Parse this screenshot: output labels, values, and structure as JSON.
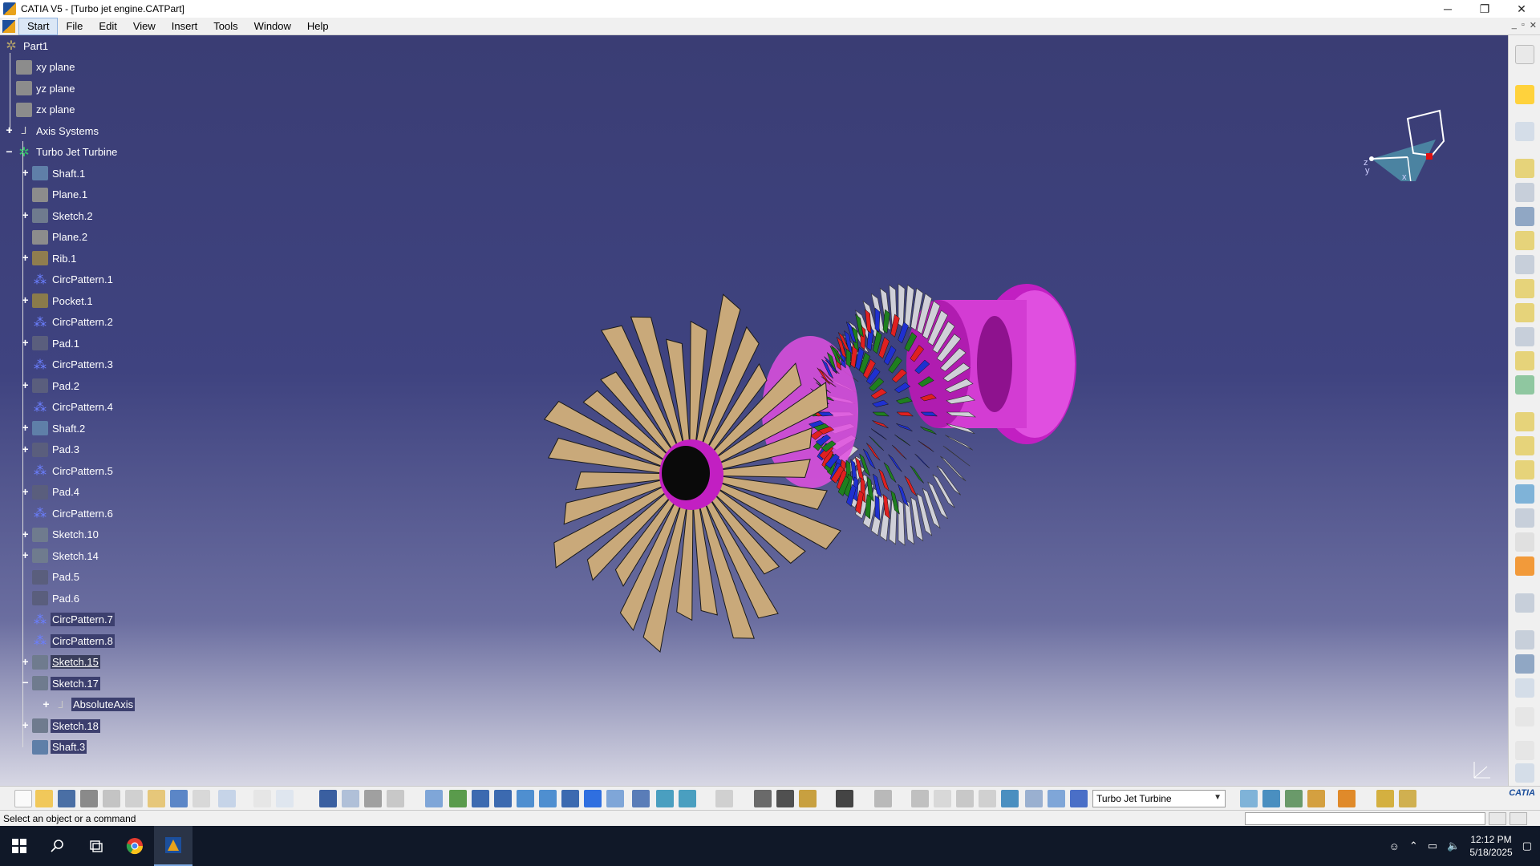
{
  "window": {
    "title": "CATIA V5 - [Turbo jet engine.CATPart]",
    "minimize": "─",
    "maximize": "❐",
    "close": "✕"
  },
  "menu": {
    "items": [
      "Start",
      "File",
      "Edit",
      "View",
      "Insert",
      "Tools",
      "Window",
      "Help"
    ],
    "mdi": [
      "_",
      "▫",
      "✕"
    ]
  },
  "tree": {
    "root": "Part1",
    "nodes": [
      {
        "label": "xy plane",
        "icon": "plane-icon"
      },
      {
        "label": "yz plane",
        "icon": "plane-icon"
      },
      {
        "label": "zx plane",
        "icon": "plane-icon"
      },
      {
        "label": "Axis Systems",
        "icon": "axis-system-icon"
      },
      {
        "label": "Turbo Jet Turbine",
        "icon": "part-body-icon"
      },
      {
        "label": "Shaft.1",
        "icon": "shaft-icon"
      },
      {
        "label": "Plane.1",
        "icon": "plane-icon"
      },
      {
        "label": "Sketch.2",
        "icon": "sketch-icon"
      },
      {
        "label": "Plane.2",
        "icon": "plane-icon"
      },
      {
        "label": "Rib.1",
        "icon": "rib-icon"
      },
      {
        "label": "CircPattern.1",
        "icon": "circ-pattern-icon"
      },
      {
        "label": "Pocket.1",
        "icon": "pocket-icon"
      },
      {
        "label": "CircPattern.2",
        "icon": "circ-pattern-icon"
      },
      {
        "label": "Pad.1",
        "icon": "pad-icon"
      },
      {
        "label": "CircPattern.3",
        "icon": "circ-pattern-icon"
      },
      {
        "label": "Pad.2",
        "icon": "pad-icon"
      },
      {
        "label": "CircPattern.4",
        "icon": "circ-pattern-icon"
      },
      {
        "label": "Shaft.2",
        "icon": "shaft-icon"
      },
      {
        "label": "Pad.3",
        "icon": "pad-icon"
      },
      {
        "label": "CircPattern.5",
        "icon": "circ-pattern-icon"
      },
      {
        "label": "Pad.4",
        "icon": "pad-icon"
      },
      {
        "label": "CircPattern.6",
        "icon": "circ-pattern-icon"
      },
      {
        "label": "Sketch.10",
        "icon": "sketch-icon"
      },
      {
        "label": "Sketch.14",
        "icon": "sketch-icon"
      },
      {
        "label": "Pad.5",
        "icon": "pad-icon"
      },
      {
        "label": "Pad.6",
        "icon": "pad-icon"
      },
      {
        "label": "CircPattern.7",
        "icon": "circ-pattern-icon"
      },
      {
        "label": "CircPattern.8",
        "icon": "circ-pattern-icon"
      },
      {
        "label": "Sketch.15",
        "icon": "sketch-icon"
      },
      {
        "label": "Sketch.17",
        "icon": "sketch-icon"
      },
      {
        "label": "AbsoluteAxis",
        "icon": "absolute-axis-icon"
      },
      {
        "label": "Sketch.18",
        "icon": "sketch-icon"
      },
      {
        "label": "Shaft.3",
        "icon": "shaft-icon"
      }
    ]
  },
  "compass": {
    "x_label": "x",
    "y_label": "y",
    "z_label": "z"
  },
  "bottom_toolbar": {
    "current_body": "Turbo Jet Turbine",
    "logo": "CATIA"
  },
  "status": {
    "message": "Select an object or a command"
  },
  "taskbar": {
    "time": "12:12 PM",
    "date": "5/18/2025"
  },
  "colors": {
    "viewport_top": "#3a3d74",
    "fan_blade": "#c9a97a",
    "spinner": "#e04fe0",
    "stage_red": "#e02020",
    "stage_green": "#1f7f1f",
    "stage_blue": "#1f30d0",
    "compressor_grey": "#d0d0d8"
  }
}
